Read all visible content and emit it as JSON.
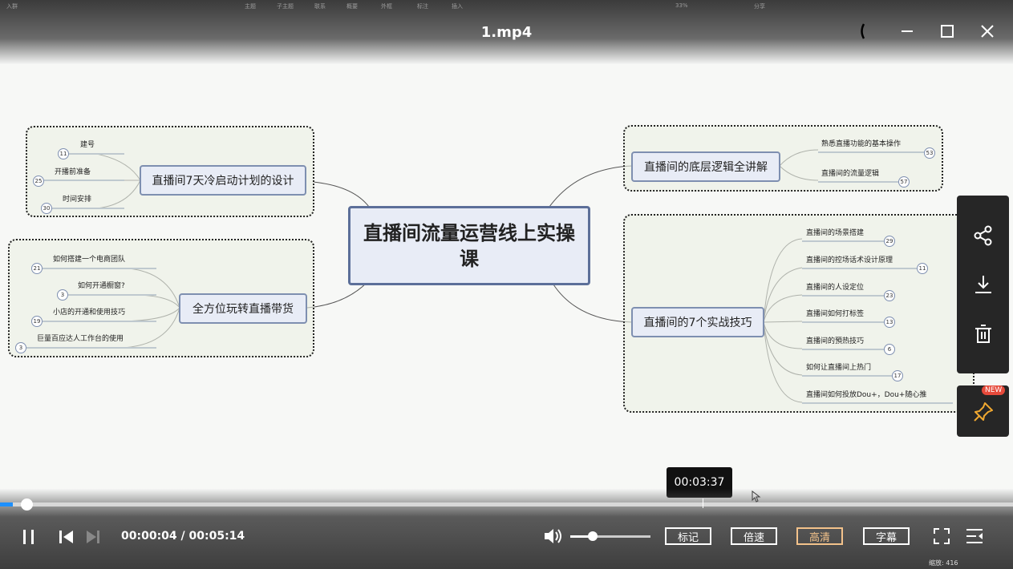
{
  "window": {
    "title": "1.mp4"
  },
  "ghost_toolbar": {
    "left_label": "入群",
    "items": [
      "主题",
      "子主题",
      "联系",
      "概要",
      "外框",
      "标注",
      "插入"
    ],
    "zoom": "33%",
    "share": "分享"
  },
  "mindmap": {
    "central": "直播间流量运营线上实操课",
    "branches": {
      "cold_start": {
        "label": "直播间7天冷启动计划的设计",
        "leaves": [
          {
            "text": "建号",
            "count": "11"
          },
          {
            "text": "开播前准备",
            "count": "25"
          },
          {
            "text": "时间安排",
            "count": "30"
          }
        ]
      },
      "selling": {
        "label": "全方位玩转直播带货",
        "leaves": [
          {
            "text": "如何搭建一个电商团队",
            "count": "21"
          },
          {
            "text": "如何开通橱窗?",
            "count": "3"
          },
          {
            "text": "小店的开通和使用技巧",
            "count": "19"
          },
          {
            "text": "巨量百应达人工作台的使用",
            "count": "3"
          }
        ]
      },
      "logic": {
        "label": "直播间的底层逻辑全讲解",
        "leaves": [
          {
            "text": "熟悉直播功能的基本操作",
            "count": "53"
          },
          {
            "text": "直播间的流量逻辑",
            "count": "57"
          }
        ]
      },
      "skills": {
        "label": "直播间的7个实战技巧",
        "leaves": [
          {
            "text": "直播间的场景搭建",
            "count": "29"
          },
          {
            "text": "直播间的控场话术设计原理",
            "count": "11"
          },
          {
            "text": "直播间的人设定位",
            "count": "23"
          },
          {
            "text": "直播间如何打标签",
            "count": "13"
          },
          {
            "text": "直播间的預热技巧",
            "count": "6"
          },
          {
            "text": "如何让直播间上热门",
            "count": "17"
          },
          {
            "text": "直播间如何投放Dou+，Dou+随心推",
            "count": ""
          }
        ]
      }
    }
  },
  "side_panel": {
    "share_icon": "share-icon",
    "download_icon": "download-icon",
    "delete_icon": "trash-icon",
    "pin_icon": "pin-icon",
    "new_badge": "NEW"
  },
  "player": {
    "hover_time": "00:03:37",
    "current_time": "00:00:04",
    "total_time": "00:05:14",
    "time_display": "00:00:04 / 00:05:14",
    "progress": 0.013,
    "volume": 0.28,
    "buttons": {
      "mark": "标记",
      "speed": "倍速",
      "quality": "高清",
      "subtitle": "字幕"
    },
    "accent": "#1e90ff",
    "quality_color": "#f3c28b",
    "footer": {
      "zoom": "缩放: 416"
    }
  }
}
